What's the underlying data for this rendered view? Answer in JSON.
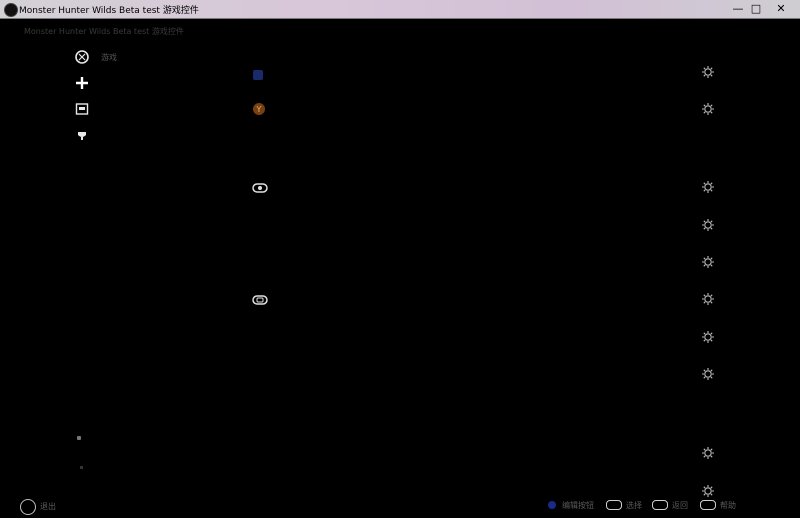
{
  "window": {
    "title": "Monster Hunter Wilds Beta test 游戏控件",
    "minimize_label": "—",
    "maximize_label": "□",
    "close_label": "✕"
  },
  "breadcrumb": "Monster Hunter Wilds Beta test 游戏控件",
  "sidebar": {
    "items": [
      {
        "icon": "xbox-icon",
        "label": "游戏"
      },
      {
        "icon": "plus-icon",
        "label": ""
      },
      {
        "icon": "controller-screen-icon",
        "label": ""
      },
      {
        "icon": "trophy-icon",
        "label": ""
      }
    ]
  },
  "rows": [
    {
      "label": "",
      "value": "",
      "icon": "blue-square-icon"
    },
    {
      "label": "",
      "value": "",
      "icon": "orange-y-button-icon"
    },
    {
      "label": "",
      "value": "",
      "icon": "left-stick-icon"
    },
    {
      "label": "",
      "value": "",
      "icon": ""
    },
    {
      "label": "",
      "value": "",
      "icon": ""
    },
    {
      "label": "",
      "value": "",
      "icon": "right-stick-icon"
    },
    {
      "label": "",
      "value": "",
      "icon": ""
    },
    {
      "label": "",
      "value": "",
      "icon": ""
    },
    {
      "label": "",
      "value": "",
      "icon": ""
    },
    {
      "label": "",
      "value": "",
      "icon": ""
    }
  ],
  "footer": {
    "left_label": "退出",
    "hints": [
      "编辑按钮",
      "选择",
      "返回",
      "帮助"
    ]
  },
  "colors": {
    "background": "#000000",
    "accent_blue": "#1a3a8a",
    "accent_orange": "#b8651b",
    "titlebar": "#d6c8d8"
  }
}
